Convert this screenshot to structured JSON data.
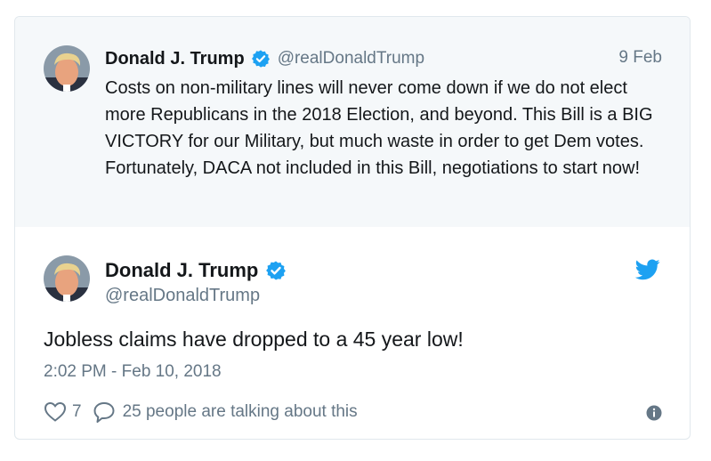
{
  "parent_tweet": {
    "name": "Donald J. Trump",
    "handle": "@realDonaldTrump",
    "date": "9 Feb",
    "text": "Costs on non-military lines will never come down if we do not elect more Republicans in the 2018 Election, and beyond. This Bill is a BIG VICTORY for our Military, but much waste in order to get Dem votes. Fortunately, DACA not included in this Bill, negotiations to start now!"
  },
  "main_tweet": {
    "name": "Donald J. Trump",
    "handle": "@realDonaldTrump",
    "text": "Jobless claims have dropped to a 45 year low!",
    "timestamp": "2:02 PM - Feb 10, 2018",
    "like_count": "7",
    "talk_label": "25 people are talking about this"
  },
  "colors": {
    "verified": "#1da1f2",
    "twitter_brand": "#1da1f2",
    "secondary_text": "#657786",
    "parent_background": "#f5f8fa"
  },
  "icons": {
    "verified": "verified-badge-icon",
    "brand": "twitter-bird-icon",
    "like": "heart-icon",
    "reply": "speech-bubble-icon",
    "info": "info-icon"
  }
}
